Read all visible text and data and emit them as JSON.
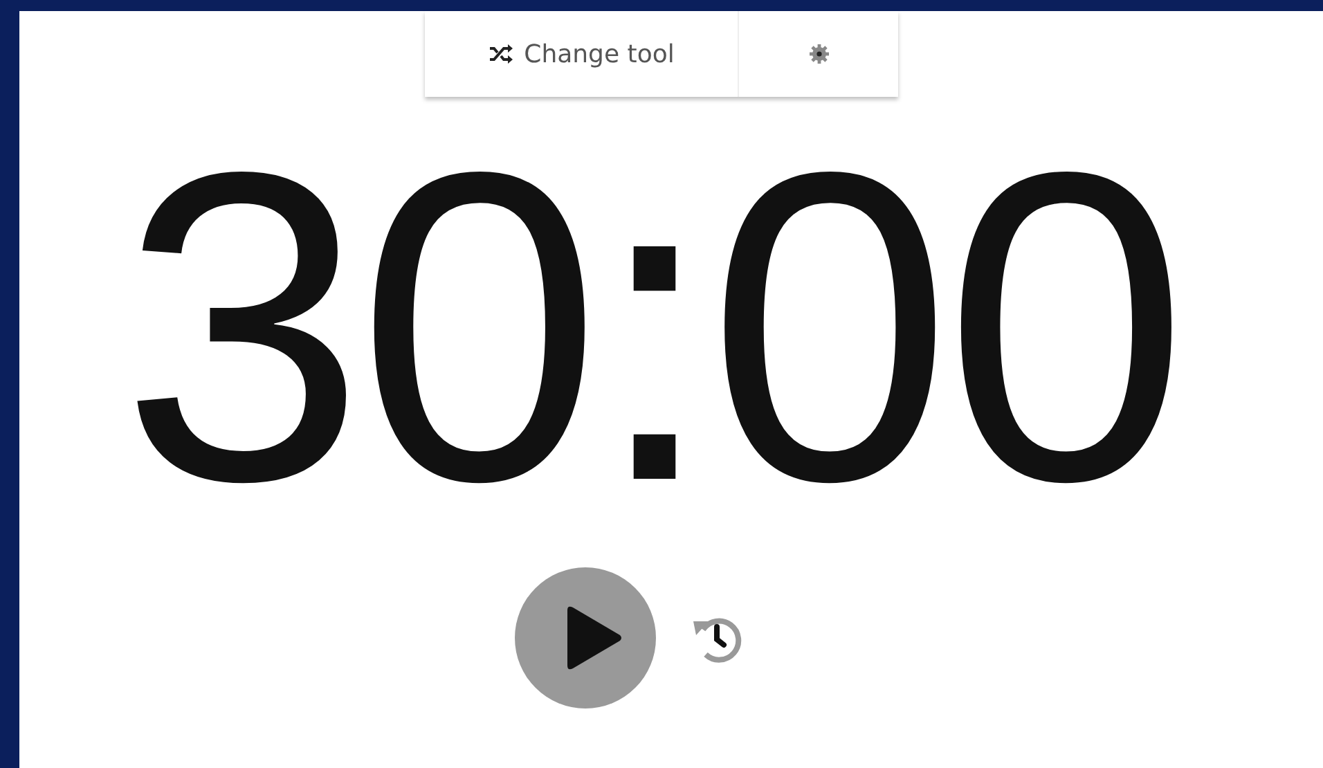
{
  "toolbar": {
    "change_tool_label": "Change tool"
  },
  "timer": {
    "display": "30:00"
  }
}
